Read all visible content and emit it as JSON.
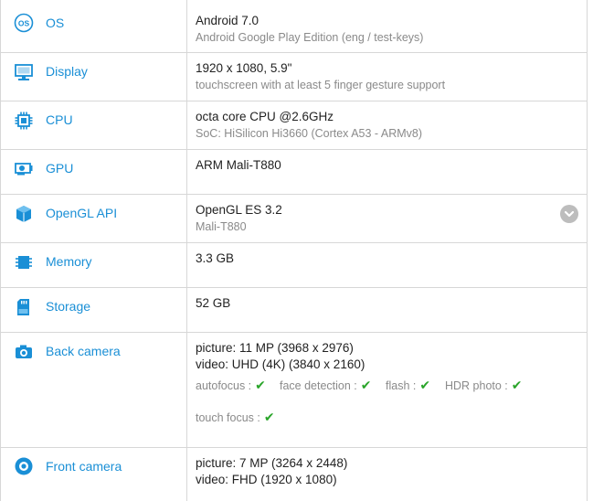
{
  "specs": {
    "os": {
      "label": "OS",
      "icon": "os-icon",
      "value": "Android 7.0",
      "detail": "Android Google Play Edition (eng / test-keys)"
    },
    "display": {
      "label": "Display",
      "icon": "monitor-icon",
      "value": "1920 x 1080, 5.9\"",
      "detail": "touchscreen with at least 5 finger gesture support"
    },
    "cpu": {
      "label": "CPU",
      "icon": "chip-icon",
      "value": "octa core CPU @2.6GHz",
      "detail": "SoC: HiSilicon Hi3660 (Cortex A53 - ARMv8)"
    },
    "gpu": {
      "label": "GPU",
      "icon": "graphics-card-icon",
      "value": "ARM Mali-T880"
    },
    "opengl": {
      "label": "OpenGL API",
      "icon": "cube-icon",
      "value": "OpenGL ES 3.2",
      "detail": "Mali-T880"
    },
    "memory": {
      "label": "Memory",
      "icon": "memory-icon",
      "value": "3.3 GB"
    },
    "storage": {
      "label": "Storage",
      "icon": "sd-card-icon",
      "value": "52 GB"
    },
    "back_camera": {
      "label": "Back camera",
      "icon": "camera-icon",
      "picture": "picture: 11 MP (3968 x 2976)",
      "video": "video: UHD (4K) (3840 x 2160)",
      "features": [
        "autofocus :",
        "face detection :",
        "flash :",
        "HDR photo :",
        "touch focus :"
      ],
      "check_symbol": "✔"
    },
    "front_camera": {
      "label": "Front camera",
      "icon": "front-camera-icon",
      "picture": "picture: 7 MP (3264 x 2448)",
      "video": "video: FHD (1920 x 1080)"
    }
  },
  "colors": {
    "accent": "#1a8fd6",
    "border": "#d7d7d7",
    "check": "#2aa52a",
    "muted": "#8a8a8a"
  }
}
